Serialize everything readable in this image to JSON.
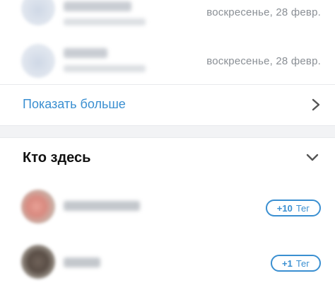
{
  "visits": [
    {
      "date": "воскресенье, 28 февр."
    },
    {
      "date": "воскресенье, 28 февр."
    }
  ],
  "show_more": {
    "label": "Показать больше"
  },
  "who_here": {
    "title": "Кто здесь",
    "people": [
      {
        "tag_count": "+10",
        "tag_label": "Тег"
      },
      {
        "tag_count": "+1",
        "tag_label": "Тег"
      }
    ]
  },
  "colors": {
    "accent": "#3a8fd1",
    "muted_text": "#8a8f95",
    "divider": "#e8eaed"
  }
}
